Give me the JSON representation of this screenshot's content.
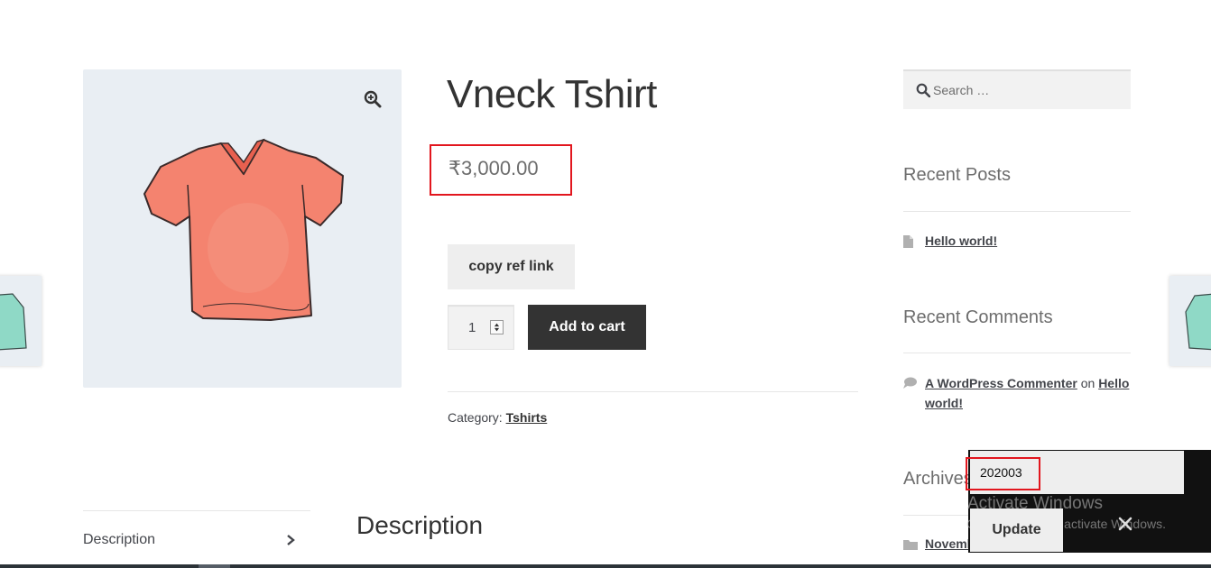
{
  "product": {
    "title": "Vneck Tshirt",
    "price": "₹3,000.00",
    "ref_button_label": "copy ref link",
    "quantity": "1",
    "add_to_cart_label": "Add to cart",
    "category_label": "Category: ",
    "category_link": "Tshirts"
  },
  "tabs": {
    "description_tab": "Description",
    "description_heading": "Description"
  },
  "sidebar": {
    "search_placeholder": "Search …",
    "recent_posts_title": "Recent Posts",
    "recent_posts": [
      "Hello world!"
    ],
    "recent_comments_title": "Recent Comments",
    "comment": {
      "author": "A WordPress Commenter",
      "joiner": " on ",
      "post": "Hello world!"
    },
    "archives_title": "Archives",
    "archive_item": "Novemb"
  },
  "overlay": {
    "input_value": "202003",
    "update_label": "Update"
  },
  "watermark": {
    "line1": "Activate Windows",
    "line2": "Go to Settings to activate Windows."
  },
  "colors": {
    "highlight": "#e2161e",
    "dark_button": "#333333",
    "gallery_bg": "#e9eef3"
  },
  "icons": [
    "zoom-icon",
    "search-icon",
    "document-icon",
    "comment-bubble-icon",
    "folder-icon",
    "chevron-right-icon",
    "close-icon",
    "quantity-stepper-icon"
  ]
}
